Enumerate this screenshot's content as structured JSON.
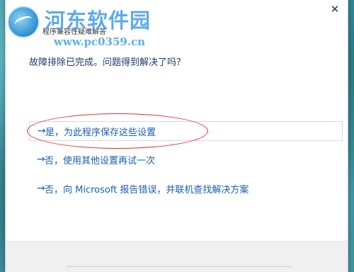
{
  "window": {
    "title": "程序兼容性疑难解答",
    "close_glyph": "✕"
  },
  "watermark": {
    "title": "河东软件园",
    "url": "www.pc0359.cn"
  },
  "question": "故障排除已完成。问题得到解决了吗?",
  "options": [
    {
      "arrow": "→",
      "label": "是，为此程序保存这些设置"
    },
    {
      "arrow": "→",
      "label": "否，使用其他设置再试一次"
    },
    {
      "arrow": "→",
      "label": "否，向 Microsoft 报告错误，并联机查找解决方案"
    }
  ],
  "colors": {
    "link": "#1a5fb4",
    "heading": "#1f3a6e",
    "annotation": "#e03030",
    "watermark": "#4da3e6"
  }
}
